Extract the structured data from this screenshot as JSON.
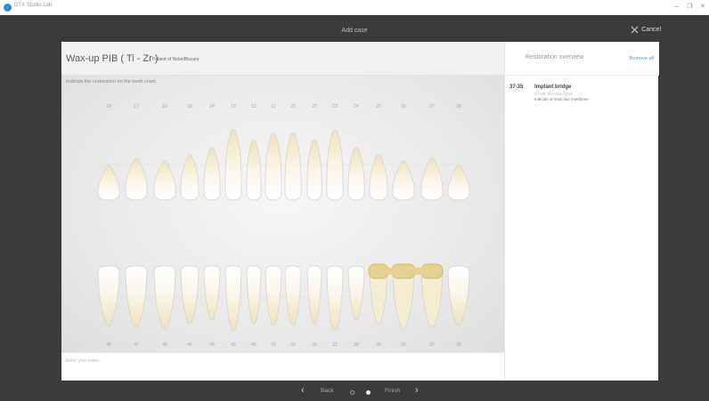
{
  "os": {
    "title": "DTX Studio Lab",
    "minimize": "–",
    "maximize": "❐",
    "close": "✕"
  },
  "header": {
    "title": "Add case",
    "cancel_label": "Cancel"
  },
  "case": {
    "title": "Wax-up PIB ( Ti - Zr )",
    "patient": "Patient of NobelBiocare"
  },
  "chart": {
    "instruction": "Indicate the restoration on the tooth chart.",
    "upper_numbers": [
      "18",
      "17",
      "16",
      "15",
      "14",
      "13",
      "12",
      "11",
      "21",
      "22",
      "23",
      "24",
      "25",
      "26",
      "27",
      "28"
    ],
    "lower_numbers": [
      "48",
      "47",
      "46",
      "45",
      "44",
      "43",
      "42",
      "41",
      "31",
      "32",
      "33",
      "34",
      "35",
      "36",
      "37",
      "38"
    ],
    "highlight_color": "#e6d092"
  },
  "notes": {
    "placeholder": "Enter your notes..."
  },
  "overview": {
    "title": "Restoration overview",
    "remove_all": "Remove all",
    "items": [
      {
        "range": "37-35",
        "name": "Implant bridge",
        "material": "HT-ML Zirconia ADoK",
        "warning": "Indicate at least two interfaces"
      }
    ]
  },
  "footer": {
    "back": "Back",
    "finish": "Finish",
    "prev_arrow": "‹",
    "next_arrow": "›"
  }
}
